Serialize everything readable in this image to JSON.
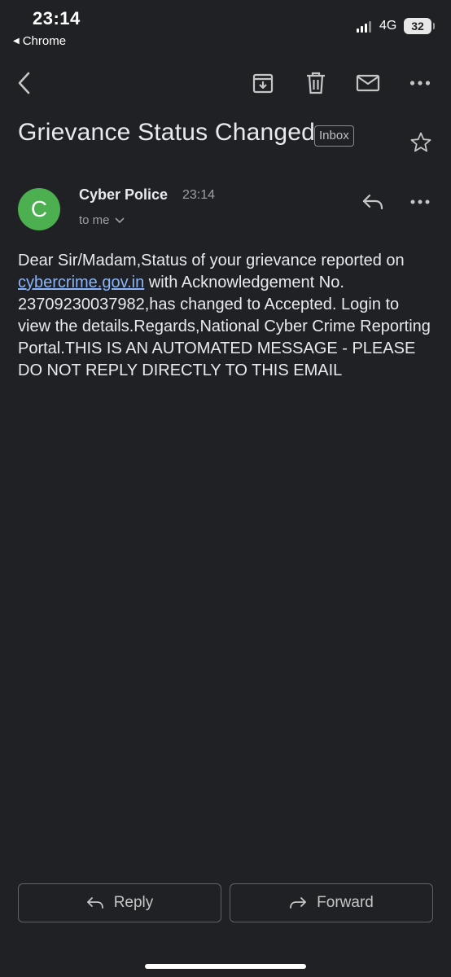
{
  "status_bar": {
    "time": "23:14",
    "back_app": "Chrome",
    "network": "4G",
    "battery": "32"
  },
  "toolbar": {
    "icons": [
      "back-icon",
      "archive-icon",
      "trash-icon",
      "mail-icon",
      "more-icon"
    ]
  },
  "email": {
    "subject": "Grievance Status Changed",
    "label": "Inbox",
    "sender": {
      "initial": "C",
      "name": "Cyber Police",
      "time": "23:14",
      "recipient": "to me",
      "avatar_color": "#4caf50"
    },
    "body": {
      "before_link": "Dear Sir/Madam,Status of your grievance reported on ",
      "link_text": "cybercrime.gov.in",
      "after_link": " with Acknowledgement No. 23709230037982,has changed to Accepted. Login to view the details.Regards,National Cyber Crime Reporting Portal.THIS IS AN AUTOMATED MESSAGE - PLEASE DO NOT REPLY DIRECTLY TO THIS EMAIL"
    }
  },
  "actions": {
    "reply_label": "Reply",
    "forward_label": "Forward"
  },
  "colors": {
    "background": "#202124",
    "link": "#8ab4f8",
    "text": "#e8eaed"
  }
}
